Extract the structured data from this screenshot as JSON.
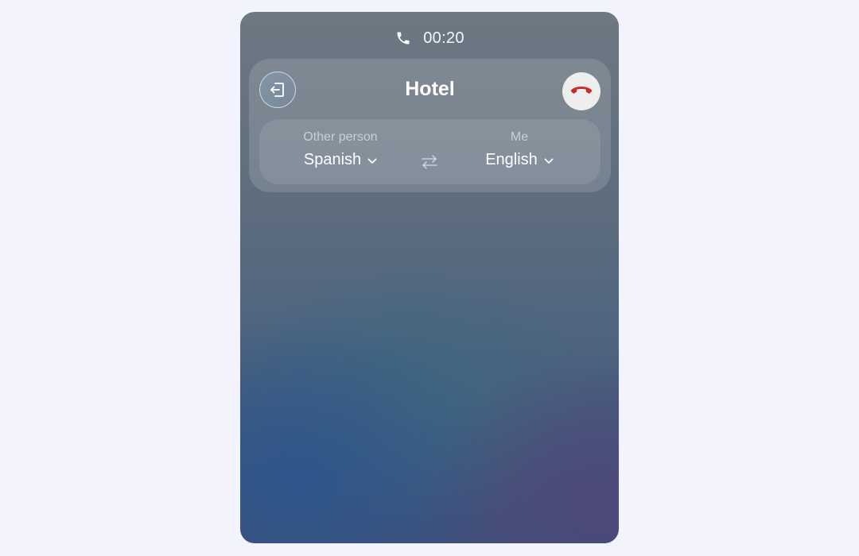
{
  "status": {
    "icon": "phone-icon",
    "timer": "00:20"
  },
  "header": {
    "title": "Hotel",
    "back_icon": "exit-icon",
    "end_call_icon": "end-call-icon",
    "end_call_color": "#c62f2c"
  },
  "languages": {
    "other": {
      "label": "Other person",
      "value": "Spanish"
    },
    "me": {
      "label": "Me",
      "value": "English"
    },
    "swap_icon": "swap-arrows-icon"
  }
}
